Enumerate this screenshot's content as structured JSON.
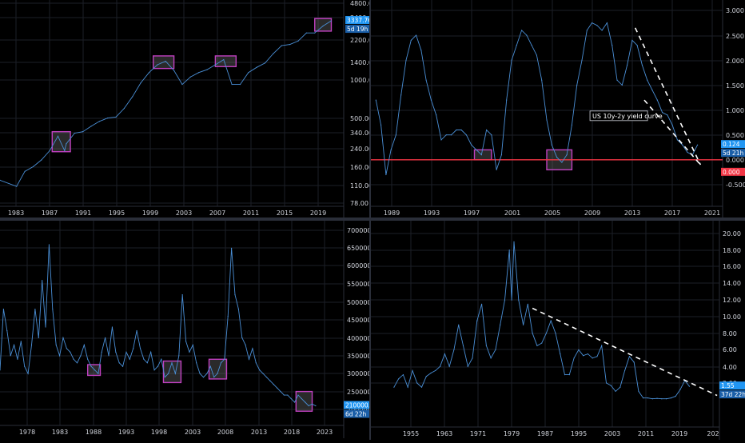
{
  "colors": {
    "background": "#000000",
    "series": "#4a8fd6",
    "grid": "#1c1f27",
    "box": "#c040c0",
    "price_badge": "#2196f3",
    "red_line": "#f23645",
    "dashed": "#ffffff"
  },
  "chart_data": [
    {
      "id": "top-left",
      "type": "line",
      "log_scale": true,
      "ylim": [
        78,
        4800
      ],
      "y_ticks": [
        "4800.00",
        "3400.00",
        "2200.00",
        "1400.00",
        "1000.00",
        "500.00",
        "340.00",
        "240.00",
        "160.00",
        "110.00",
        "78.00"
      ],
      "x_ticks": [
        "1983",
        "1987",
        "1991",
        "1995",
        "1999",
        "2003",
        "2007",
        "2011",
        "2015",
        "2019"
      ],
      "x": [
        1980,
        1982,
        1983,
        1984,
        1985,
        1986,
        1987,
        1987.8,
        1988,
        1989,
        1990,
        1991,
        1992,
        1993,
        1994,
        1995,
        1996,
        1997,
        1998,
        1999,
        2000,
        2001,
        2002,
        2003,
        2004,
        2005,
        2006,
        2007,
        2008,
        2009,
        2010,
        2011,
        2012,
        2013,
        2014,
        2015,
        2016,
        2017,
        2018,
        2019,
        2020
      ],
      "values": [
        125,
        110,
        150,
        165,
        190,
        230,
        310,
        230,
        265,
        330,
        340,
        380,
        420,
        450,
        460,
        550,
        700,
        930,
        1150,
        1350,
        1450,
        1200,
        900,
        1050,
        1150,
        1220,
        1350,
        1500,
        900,
        900,
        1150,
        1280,
        1400,
        1700,
        2000,
        2050,
        2200,
        2600,
        2600,
        3000,
        3337.76
      ],
      "highlight_boxes": [
        [
          1986.3,
          1988.5,
          225,
          340
        ],
        [
          1998.5,
          2001.0,
          1250,
          1620
        ],
        [
          2006.0,
          2008.5,
          1300,
          1620
        ],
        [
          2018.0,
          2020.0,
          2700,
          3500
        ]
      ],
      "price_label": "3337.76",
      "countdown": "5d 19h"
    },
    {
      "id": "top-right",
      "type": "line",
      "ylim": [
        -0.6,
        3.0
      ],
      "y_ticks": [
        "3.000",
        "2.500",
        "2.000",
        "1.500",
        "1.000",
        "0.500",
        "0.000",
        "-0.500"
      ],
      "x_ticks": [
        "1989",
        "1993",
        "1997",
        "2001",
        "2005",
        "2009",
        "2013",
        "2017",
        "2021"
      ],
      "x": [
        1988,
        1988.5,
        1989,
        1989.5,
        1990,
        1990.5,
        1991,
        1991.5,
        1992,
        1992.5,
        1993,
        1993.5,
        1994,
        1994.5,
        1995,
        1995.5,
        1996,
        1996.5,
        1997,
        1997.5,
        1998,
        1998.5,
        1999,
        1999.5,
        2000,
        2000.5,
        2001,
        2001.5,
        2002,
        2002.5,
        2003,
        2003.5,
        2004,
        2004.5,
        2005,
        2005.5,
        2006,
        2006.5,
        2007,
        2007.5,
        2008,
        2008.5,
        2009,
        2009.5,
        2010,
        2010.5,
        2011,
        2011.5,
        2012,
        2012.5,
        2013,
        2013.5,
        2014,
        2014.5,
        2015,
        2015.5,
        2016,
        2016.5,
        2017,
        2017.5,
        2018,
        2018.5,
        2019,
        2019.5,
        2020
      ],
      "values": [
        1.2,
        0.7,
        -0.3,
        0.2,
        0.5,
        1.3,
        2.0,
        2.4,
        2.5,
        2.2,
        1.6,
        1.2,
        0.9,
        0.4,
        0.5,
        0.5,
        0.6,
        0.6,
        0.5,
        0.3,
        0.2,
        0.1,
        0.6,
        0.5,
        -0.2,
        0.1,
        1.2,
        2.0,
        2.3,
        2.6,
        2.5,
        2.3,
        2.1,
        1.6,
        0.8,
        0.3,
        0.05,
        -0.05,
        0.1,
        0.7,
        1.5,
        2.0,
        2.6,
        2.75,
        2.7,
        2.6,
        2.75,
        2.3,
        1.6,
        1.5,
        1.9,
        2.4,
        2.3,
        1.9,
        1.6,
        1.4,
        1.2,
        0.95,
        0.9,
        0.7,
        0.4,
        0.3,
        0.15,
        0.1,
        0.3
      ],
      "highlight_boxes": [
        [
          1997.8,
          1999.5,
          0.0,
          0.2
        ],
        [
          2005.0,
          2007.5,
          -0.2,
          0.2
        ]
      ],
      "red_line_value": 0.0,
      "annotation": "US 10y-2y yield curve",
      "price_label": "0.124",
      "countdown": "5d 21h",
      "red_label": "0.000"
    },
    {
      "id": "bottom-left",
      "type": "line",
      "ylim": [
        170000,
        710000
      ],
      "y_ticks": [
        "700000.00",
        "650000.00",
        "600000.00",
        "550000.00",
        "500000.00",
        "450000.00",
        "400000.00",
        "350000.00",
        "300000.00",
        "250000.00",
        "200000.00"
      ],
      "x_ticks": [
        "1978",
        "1983",
        "1988",
        "1993",
        "1998",
        "2003",
        "2008",
        "2013",
        "2018",
        "2023"
      ],
      "x": [
        1975,
        1975.5,
        1976,
        1976.5,
        1977,
        1977.5,
        1978,
        1978.5,
        1979,
        1979.5,
        1980,
        1980.5,
        1981,
        1981.5,
        1982,
        1982.5,
        1983,
        1983.5,
        1984,
        1984.5,
        1985,
        1985.5,
        1986,
        1986.5,
        1987,
        1987.5,
        1988,
        1988.5,
        1989,
        1989.5,
        1990,
        1990.5,
        1991,
        1991.5,
        1992,
        1992.5,
        1993,
        1993.5,
        1994,
        1994.5,
        1995,
        1995.5,
        1996,
        1996.5,
        1997,
        1997.5,
        1998,
        1998.5,
        1999,
        1999.5,
        2000,
        2000.5,
        2001,
        2001.5,
        2002,
        2002.5,
        2003,
        2003.5,
        2004,
        2004.5,
        2005,
        2005.5,
        2006,
        2006.5,
        2007,
        2007.5,
        2008,
        2008.5,
        2009,
        2009.5,
        2010,
        2010.5,
        2011,
        2011.5,
        2012,
        2012.5,
        2013,
        2013.5,
        2014,
        2014.5,
        2015,
        2015.5,
        2016,
        2016.5,
        2017,
        2017.5,
        2018,
        2018.5,
        2019,
        2019.5,
        2020
      ],
      "values": [
        310000,
        480000,
        420000,
        350000,
        380000,
        340000,
        390000,
        320000,
        300000,
        380000,
        480000,
        400000,
        560000,
        430000,
        660000,
        480000,
        380000,
        350000,
        400000,
        370000,
        360000,
        340000,
        330000,
        350000,
        380000,
        340000,
        320000,
        310000,
        300000,
        360000,
        400000,
        350000,
        430000,
        360000,
        330000,
        320000,
        360000,
        340000,
        370000,
        420000,
        370000,
        340000,
        330000,
        360000,
        310000,
        320000,
        340000,
        290000,
        300000,
        330000,
        300000,
        350000,
        520000,
        390000,
        360000,
        380000,
        330000,
        300000,
        290000,
        300000,
        320000,
        290000,
        300000,
        330000,
        340000,
        460000,
        650000,
        520000,
        480000,
        400000,
        380000,
        340000,
        370000,
        330000,
        310000,
        300000,
        290000,
        280000,
        270000,
        260000,
        250000,
        240000,
        240000,
        230000,
        220000,
        240000,
        230000,
        220000,
        210000,
        215000,
        210000
      ],
      "highlight_boxes": [
        [
          1987.5,
          1989.3,
          295000,
          325000
        ],
        [
          1998.3,
          2000.8,
          275000,
          335000
        ],
        [
          2004.8,
          2007.3,
          285000,
          340000
        ],
        [
          2017.2,
          2019.5,
          195000,
          250000
        ]
      ],
      "price_label": "210000.00",
      "countdown": "6d 22h"
    },
    {
      "id": "bottom-right",
      "type": "line",
      "ylim": [
        0,
        21
      ],
      "y_ticks": [
        "20.00",
        "18.00",
        "16.00",
        "14.00",
        "12.00",
        "10.00",
        "8.00",
        "6.00",
        "4.00",
        "2.00"
      ],
      "x_ticks": [
        "1955",
        "1963",
        "1971",
        "1979",
        "1987",
        "1995",
        "2003",
        "2011",
        "2019",
        "202"
      ],
      "x": [
        1955,
        1956,
        1957,
        1958,
        1959,
        1960,
        1961,
        1962,
        1963,
        1964,
        1965,
        1966,
        1967,
        1968,
        1969,
        1970,
        1971,
        1972,
        1973,
        1974,
        1975,
        1976,
        1977,
        1978,
        1979,
        1980,
        1980.5,
        1981,
        1982,
        1983,
        1984,
        1985,
        1986,
        1987,
        1988,
        1989,
        1990,
        1991,
        1992,
        1993,
        1994,
        1995,
        1996,
        1997,
        1998,
        1999,
        2000,
        2001,
        2002,
        2003,
        2004,
        2005,
        2006,
        2007,
        2008,
        2009,
        2010,
        2011,
        2012,
        2013,
        2014,
        2015,
        2016,
        2017,
        2018,
        2019
      ],
      "values": [
        1.5,
        2.5,
        3.0,
        1.5,
        3.5,
        2.0,
        1.5,
        2.8,
        3.2,
        3.5,
        4.0,
        5.5,
        4.0,
        6.0,
        9.0,
        6.5,
        4.0,
        5.0,
        9.5,
        11.5,
        6.5,
        5.0,
        6.0,
        9.0,
        12.0,
        18.0,
        12.0,
        19.0,
        12.0,
        9.0,
        11.5,
        8.0,
        6.5,
        6.8,
        8.0,
        9.5,
        8.0,
        5.5,
        3.0,
        3.0,
        5.0,
        6.0,
        5.3,
        5.5,
        5.0,
        5.2,
        6.5,
        2.0,
        1.7,
        1.0,
        1.5,
        3.5,
        5.2,
        4.5,
        1.0,
        0.2,
        0.2,
        0.1,
        0.15,
        0.1,
        0.1,
        0.2,
        0.4,
        1.2,
        2.3,
        1.6
      ],
      "trendline": [
        [
          1985,
          11.0
        ],
        [
          2025,
          0.5
        ]
      ],
      "price_label": "1.55",
      "countdown": "37d 22h"
    }
  ]
}
